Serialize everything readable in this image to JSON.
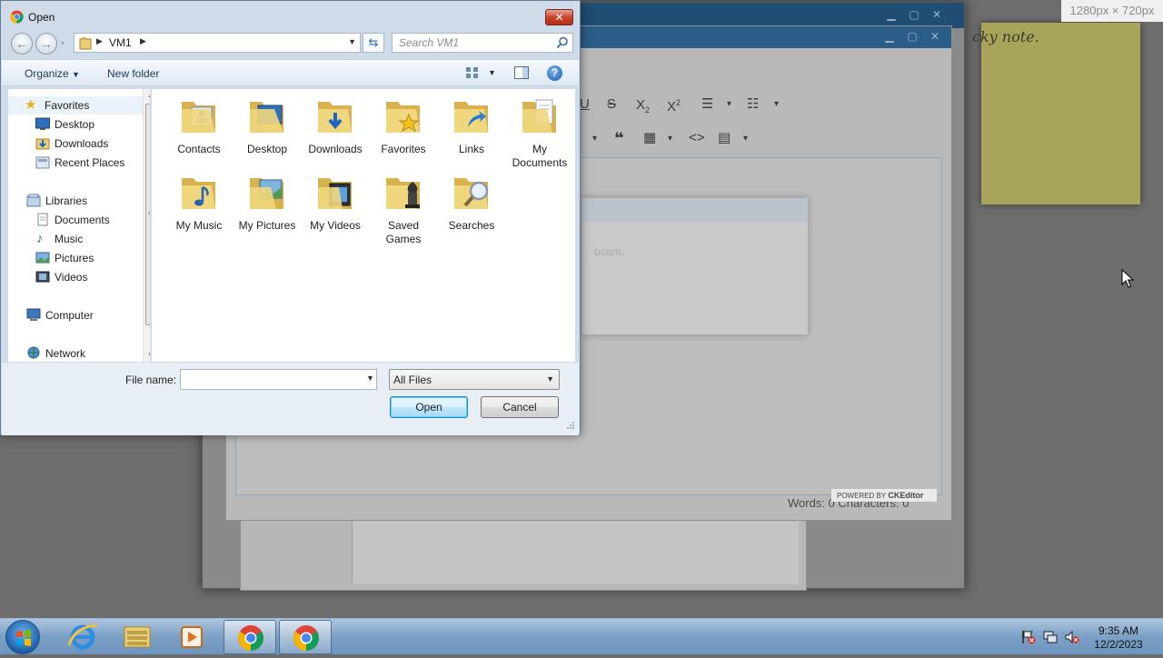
{
  "dialog": {
    "title": "Open",
    "address": {
      "current": "VM1"
    },
    "search": {
      "placeholder": "Search VM1"
    },
    "commandbar": {
      "organize": "Organize",
      "new_folder": "New folder",
      "help": "?"
    },
    "nav": {
      "favorites": "Favorites",
      "desktop": "Desktop",
      "downloads": "Downloads",
      "recent_places": "Recent Places",
      "libraries": "Libraries",
      "documents": "Documents",
      "music": "Music",
      "pictures": "Pictures",
      "videos": "Videos",
      "computer": "Computer",
      "network": "Network"
    },
    "files": [
      {
        "label": "Contacts",
        "icon": "contacts-folder-icon"
      },
      {
        "label": "Desktop",
        "icon": "desktop-folder-icon"
      },
      {
        "label": "Downloads",
        "icon": "downloads-folder-icon"
      },
      {
        "label": "Favorites",
        "icon": "favorites-folder-icon"
      },
      {
        "label": "Links",
        "icon": "links-folder-icon"
      },
      {
        "label": "My Documents",
        "icon": "documents-folder-icon"
      },
      {
        "label": "My Music",
        "icon": "music-folder-icon"
      },
      {
        "label": "My Pictures",
        "icon": "pictures-folder-icon"
      },
      {
        "label": "My Videos",
        "icon": "videos-folder-icon"
      },
      {
        "label": "Saved Games",
        "icon": "games-folder-icon"
      },
      {
        "label": "Searches",
        "icon": "searches-folder-icon"
      }
    ],
    "file_name": {
      "label": "File name:",
      "value": ""
    },
    "file_type": {
      "value": "All Files"
    },
    "open_label": "Open",
    "cancel_label": "Cancel"
  },
  "background": {
    "sticky_note_text": "cky note.",
    "resolution_label": "1280px × 720px",
    "editor_status": "Words: 0   Characters: 0",
    "ck_powered": "POWERED BY",
    "ck_brand": "CKEditor",
    "modal_text": "bcam."
  },
  "taskbar": {
    "time": "9:35 AM",
    "date": "12/2/2023"
  },
  "colors": {
    "taskbar": "#7fa3c7",
    "sticky": "#a8a55b",
    "dialog_frame": "#cfdbe8",
    "close_button": "#c7452f"
  }
}
